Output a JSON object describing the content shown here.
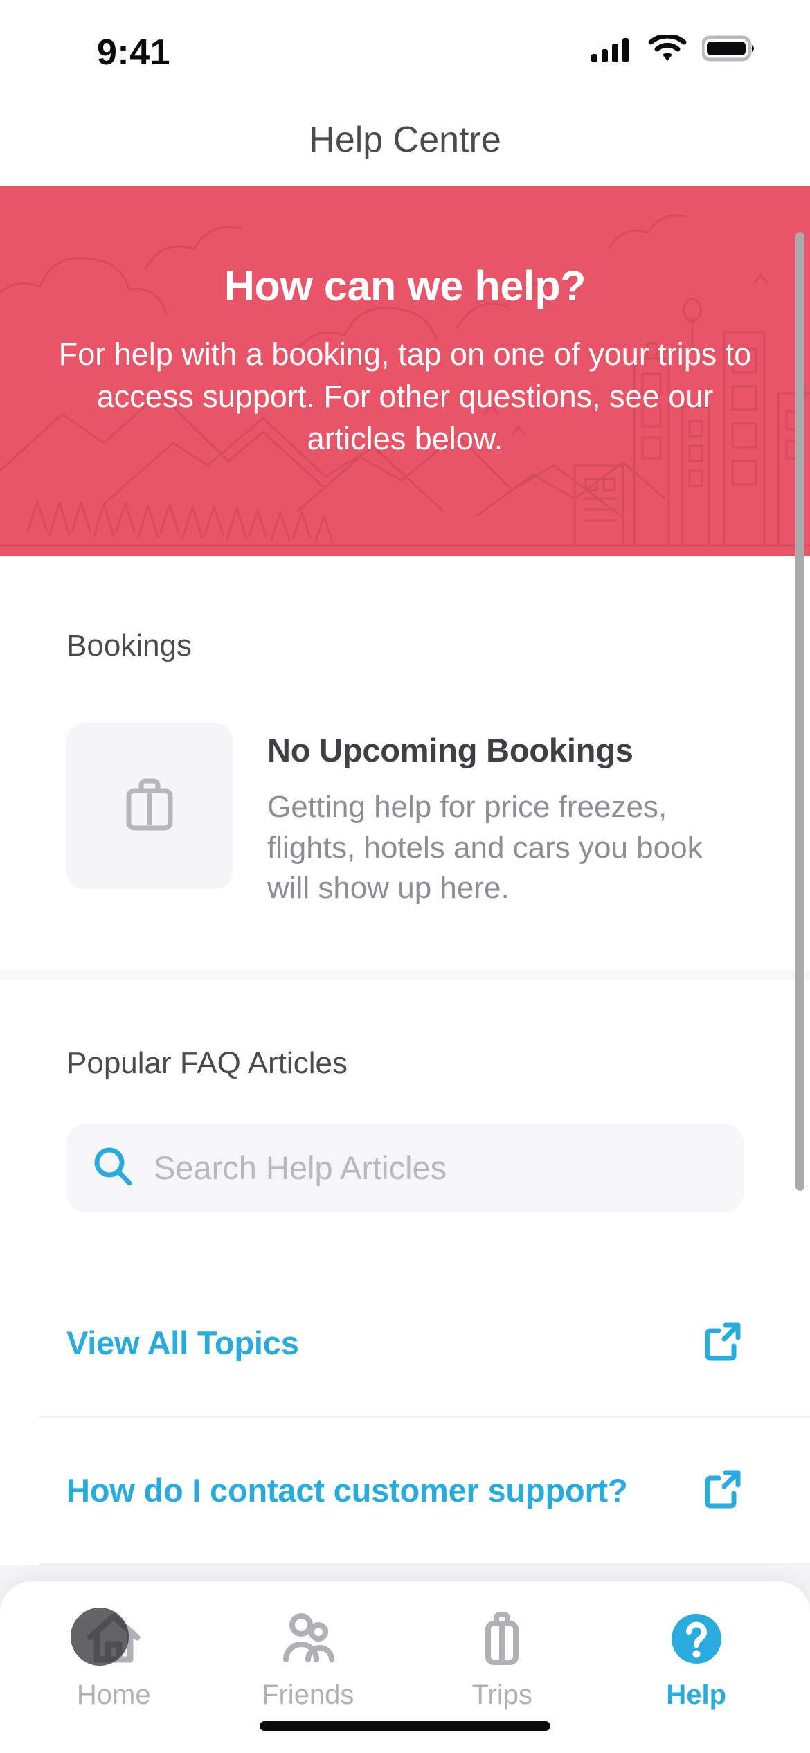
{
  "status_bar": {
    "time": "9:41",
    "signal_icon": "cellular-signal-icon",
    "wifi_icon": "wifi-icon",
    "battery_icon": "battery-full-icon"
  },
  "nav": {
    "title": "Help Centre"
  },
  "hero": {
    "title": "How can we help?",
    "subtitle": "For help with a booking, tap on one of your trips to access support. For other questions, see our articles below.",
    "background_color": "#e85568",
    "text_color": "#ffffff",
    "illustration": "city-and-mountains-line-art"
  },
  "bookings": {
    "section_title": "Bookings",
    "empty_state": {
      "icon": "briefcase-icon",
      "title": "No Upcoming Bookings",
      "description": "Getting help for price freezes, flights, hotels and cars you book will show up here."
    }
  },
  "faq": {
    "section_title": "Popular FAQ Articles",
    "search": {
      "icon": "search-icon",
      "placeholder": "Search Help Articles",
      "value": ""
    },
    "links": [
      {
        "label": "View All Topics",
        "icon": "external-link-icon"
      },
      {
        "label": "How do I contact customer support?",
        "icon": "external-link-icon"
      }
    ]
  },
  "tab_bar": {
    "active_color": "#29abdd",
    "inactive_color": "#b0b0b6",
    "items": [
      {
        "label": "Home",
        "icon": "home-icon",
        "active": false
      },
      {
        "label": "Friends",
        "icon": "friends-icon",
        "active": false
      },
      {
        "label": "Trips",
        "icon": "briefcase-icon",
        "active": false
      },
      {
        "label": "Help",
        "icon": "question-mark-circle-icon",
        "active": true
      }
    ]
  },
  "colors": {
    "brand_red": "#e85568",
    "accent_cyan": "#29abdd",
    "text_dark": "#4a4a4f",
    "text_muted": "#8d8d94"
  }
}
